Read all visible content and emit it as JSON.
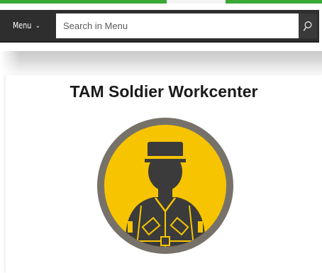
{
  "colors": {
    "accent_green": "#39a834",
    "menu_bar": "#2e2e2e",
    "badge_yellow": "#f6c400",
    "badge_ring": "#777269",
    "figure": "#3b3b3b"
  },
  "menu_bar": {
    "menu_label": "Menu",
    "menu_chevron": "⌄",
    "search_placeholder": "Search in Menu",
    "search_icon": "search-icon"
  },
  "workcenter": {
    "title": "TAM Soldier Workcenter",
    "icon": "soldier-icon"
  }
}
